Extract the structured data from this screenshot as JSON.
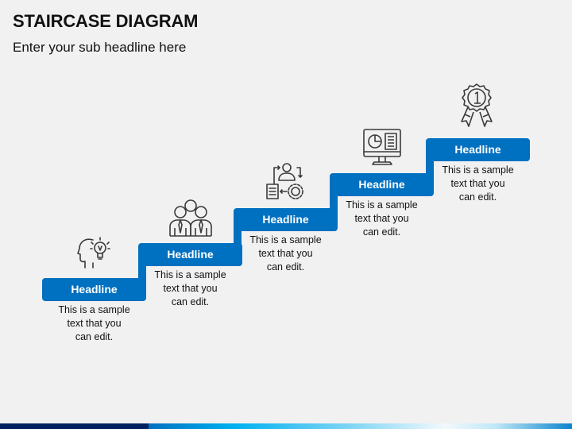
{
  "header": {
    "title": "STAIRCASE DIAGRAM",
    "subtitle": "Enter your sub headline here"
  },
  "colors": {
    "step_blue": "#0070C0",
    "icon_stroke": "#3a3a3a",
    "background": "#F1F1F1",
    "footer_navy": "#002060"
  },
  "steps": [
    {
      "headline": "Headline",
      "text": [
        "This is a sample",
        "text that you",
        "can edit."
      ],
      "icon": "head-lightbulb-icon"
    },
    {
      "headline": "Headline",
      "text": [
        "This is a sample",
        "text that you",
        "can edit."
      ],
      "icon": "team-people-icon"
    },
    {
      "headline": "Headline",
      "text": [
        "This is a sample",
        "text that you",
        "can edit."
      ],
      "icon": "workflow-process-icon"
    },
    {
      "headline": "Headline",
      "text": [
        "This is a sample",
        "text that you",
        "can edit."
      ],
      "icon": "monitor-dashboard-icon"
    },
    {
      "headline": "Headline",
      "text": [
        "This is a sample",
        "text that you",
        "can edit."
      ],
      "icon": "award-ribbon-icon"
    }
  ]
}
